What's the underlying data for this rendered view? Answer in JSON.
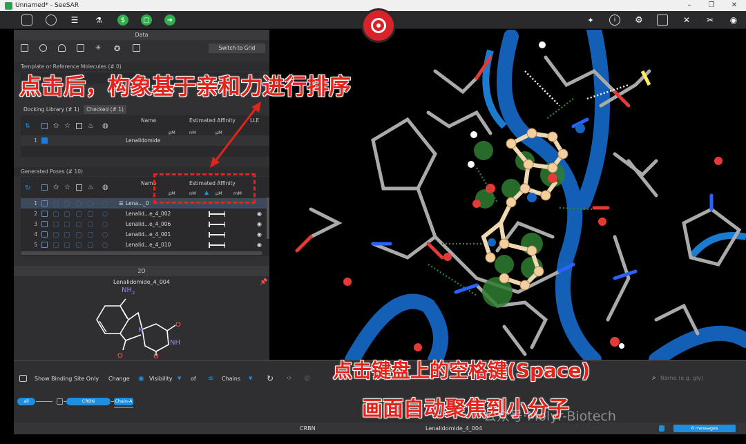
{
  "window": {
    "title": "Unnamed* - SeeSAR"
  },
  "toolbar": {
    "left_icons": [
      "file-icon",
      "globe-icon",
      "sliders-icon",
      "flask-icon",
      "dollar-icon",
      "puzzle-icon",
      "arrow-icon"
    ],
    "right_icons": [
      "wand-icon",
      "info-icon",
      "gear-icon",
      "monitor-icon",
      "tools-icon",
      "wrench-icon",
      "eye-icon"
    ]
  },
  "data_panel": {
    "header": "Data",
    "switch_grid": "Switch to Grid",
    "template_header": "Template or Reference Molecules (# 0)",
    "docking_tab": "Docking Library (# 1)",
    "checked_tab": "Checked (# 1)",
    "cols": {
      "name": "Name",
      "affinity": "Estimated Affinity",
      "lle": "LLE",
      "units": [
        "pM",
        "nM",
        "µM"
      ],
      "units_poses": [
        "pM",
        "nM",
        "µM",
        "mM"
      ]
    },
    "docking_rows": [
      {
        "num": "1",
        "name": "Lenalidomide",
        "checked": true
      }
    ],
    "poses_header": "Generated Poses (# 10)",
    "pose_rows": [
      {
        "num": "1",
        "name": "Lena..._0"
      },
      {
        "num": "2",
        "name": "Lenalid...e_4_002"
      },
      {
        "num": "3",
        "name": "Lenalid...e_4_006"
      },
      {
        "num": "4",
        "name": "Lenalid...e_4_001"
      },
      {
        "num": "5",
        "name": "Lenalid...e_4_010"
      }
    ]
  },
  "panel_2d": {
    "header": "2D",
    "molecule_name": "Lenalidomide_4_004",
    "labels": {
      "nh2": "NH",
      "sub2": "2",
      "n": "N",
      "nh": "NH",
      "o": "O"
    }
  },
  "bottom": {
    "show_binding": "Show Binding Site Only",
    "change": "Change",
    "visibility": "Visibility",
    "of": "of",
    "chains": "Chains",
    "search_placeholder": "Name (e.g. gly)",
    "pills": {
      "all": "all",
      "crbn": "CRBN",
      "chain": "Chain-A"
    }
  },
  "status": {
    "left": "CRBN",
    "center": "Lenalidomide_4_004",
    "messages": "6 messages"
  },
  "annotations": {
    "top": "点击后，构象基于亲和力进行排序",
    "bottom1": "点击键盘上的空格键(Space)",
    "bottom2": "画面自动聚焦到小分子",
    "watermark": "公众号·Molyr-Biotech"
  },
  "colors": {
    "accent": "#1e8fe0",
    "annotation_red": "#e2241c",
    "logo_red": "#d8232a"
  }
}
